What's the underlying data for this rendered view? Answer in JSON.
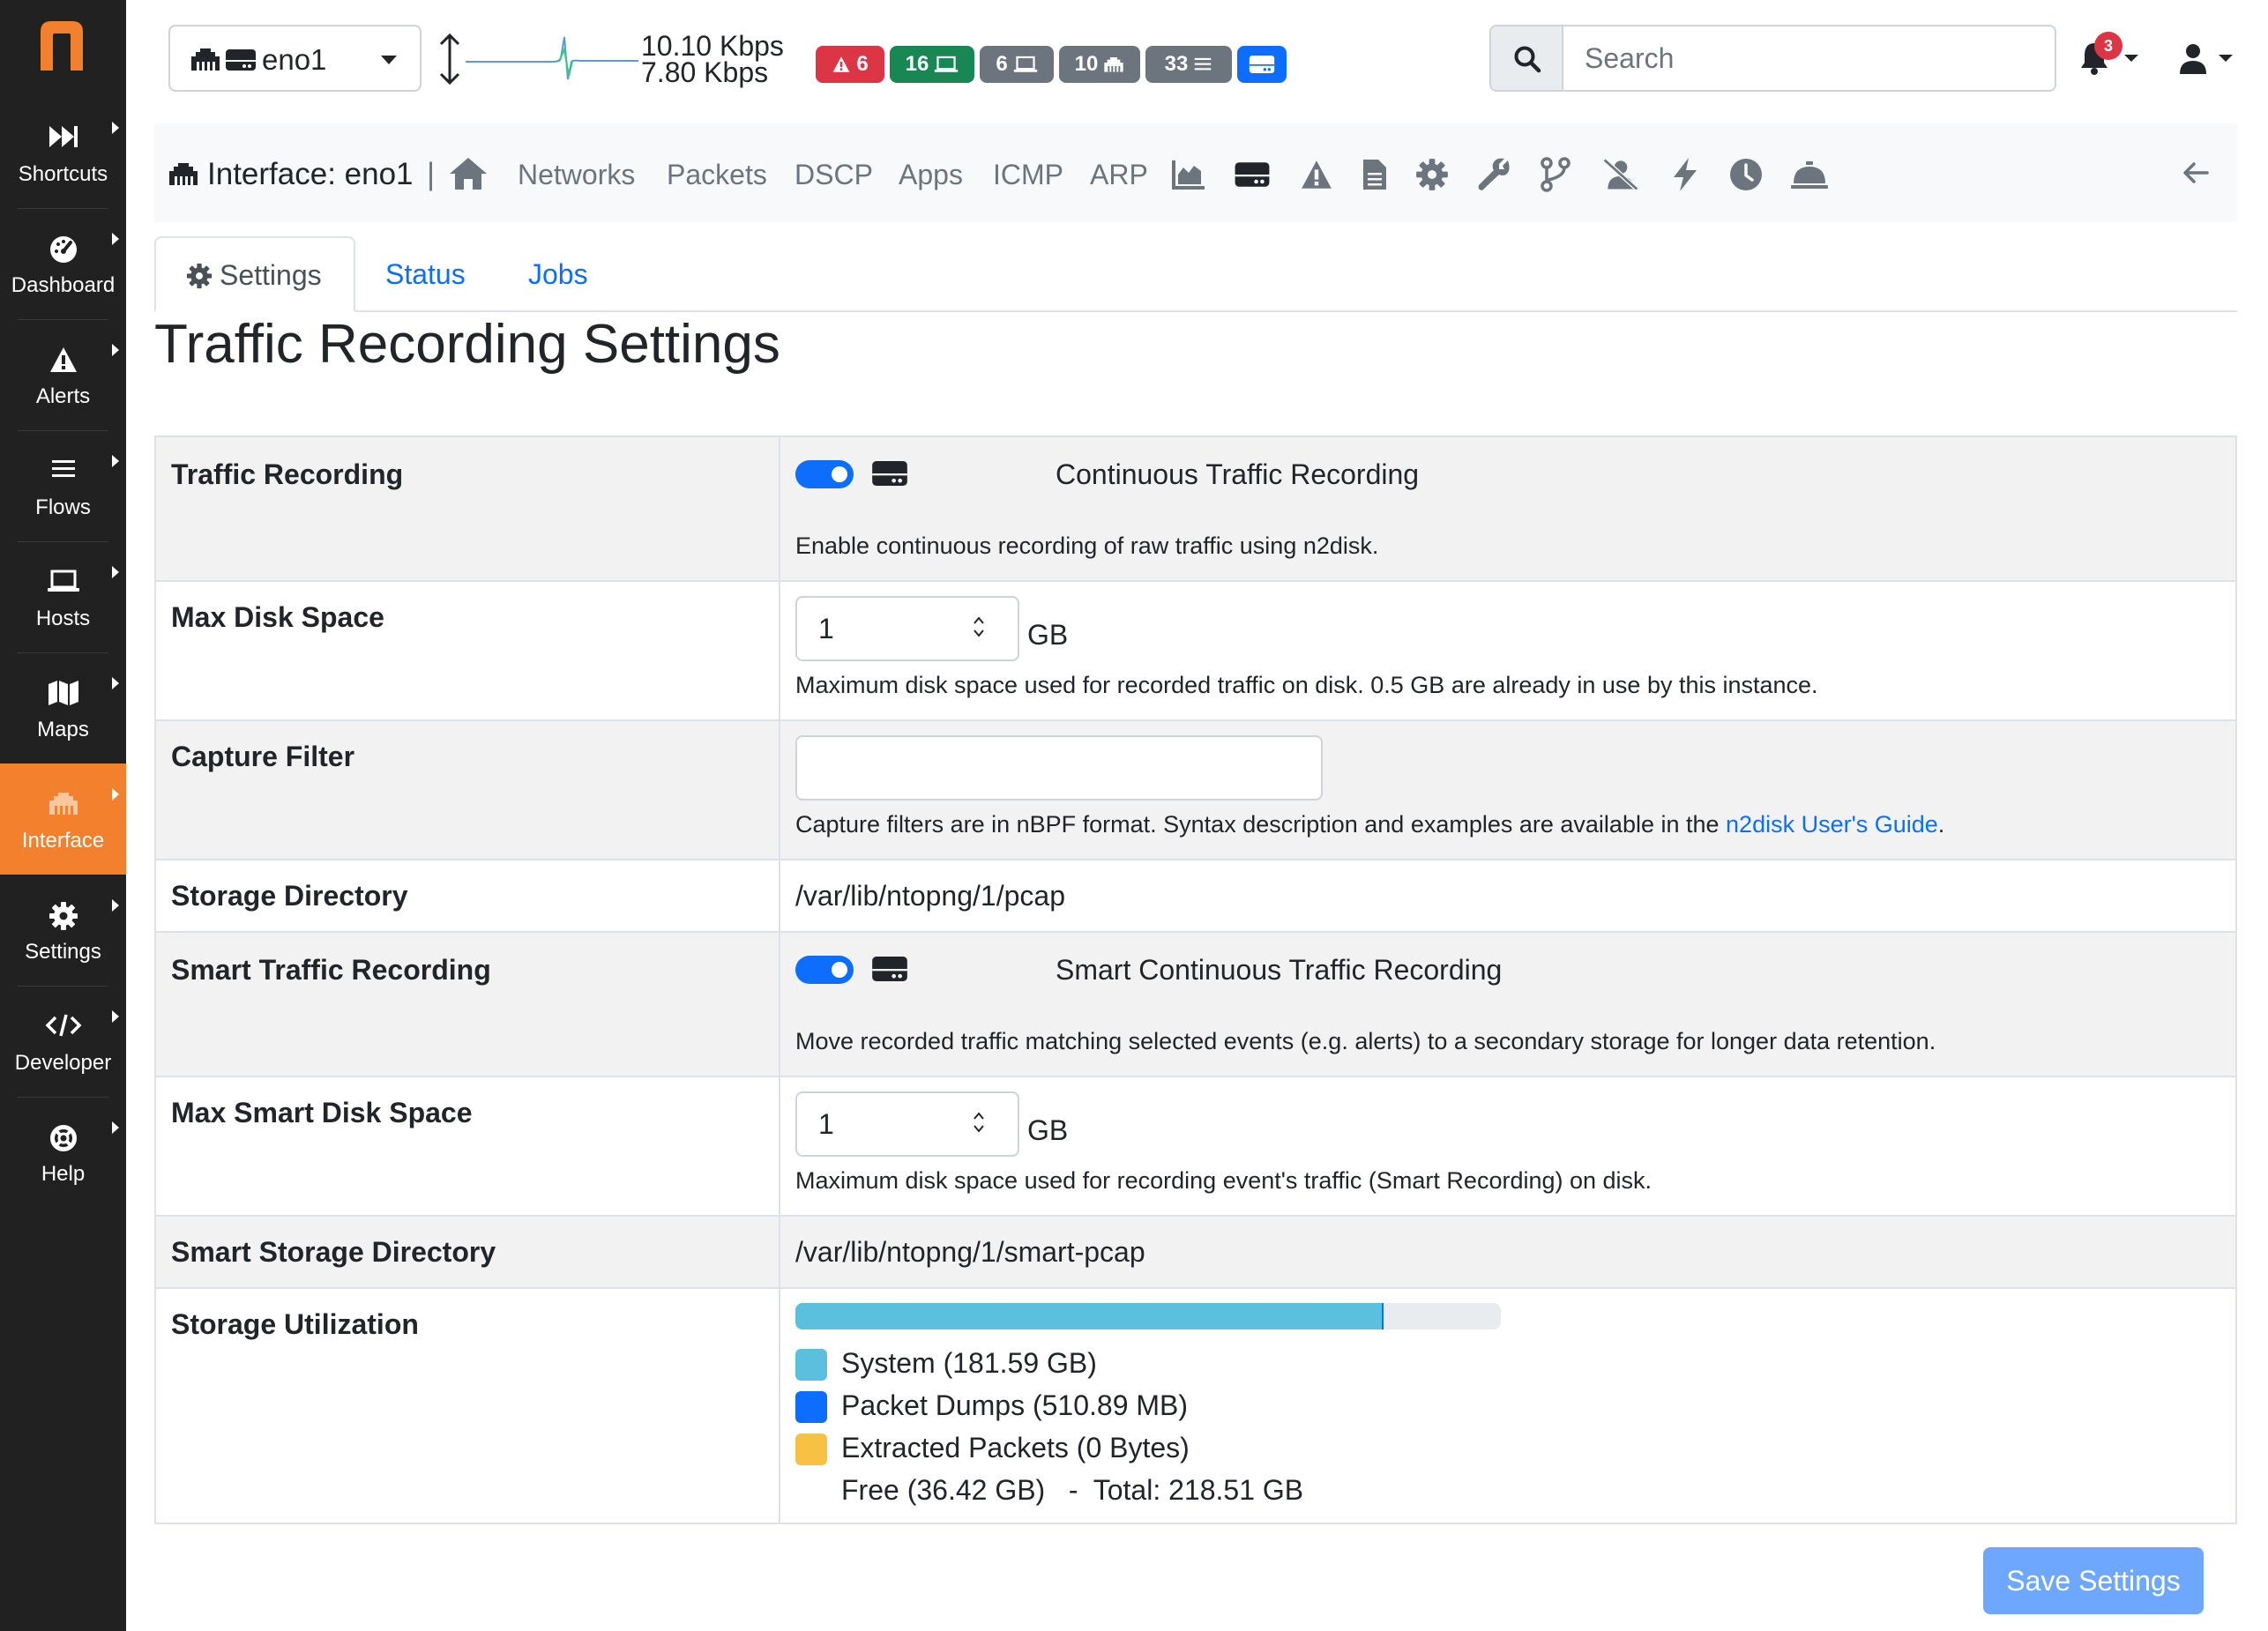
{
  "sidebar": {
    "logo": "n",
    "items": [
      {
        "label": "Shortcuts",
        "icon": "fast-forward-icon"
      },
      {
        "label": "Dashboard",
        "icon": "gauge-icon"
      },
      {
        "label": "Alerts",
        "icon": "warning-icon"
      },
      {
        "label": "Flows",
        "icon": "bars-icon"
      },
      {
        "label": "Hosts",
        "icon": "laptop-icon"
      },
      {
        "label": "Maps",
        "icon": "map-icon"
      },
      {
        "label": "Interface",
        "icon": "ethernet-icon"
      },
      {
        "label": "Settings",
        "icon": "gear-icon"
      },
      {
        "label": "Developer",
        "icon": "code-icon"
      },
      {
        "label": "Help",
        "icon": "lifebuoy-icon"
      }
    ],
    "active": "Interface"
  },
  "topbar": {
    "interface_label": "eno1",
    "rate_up": "10.10 Kbps",
    "rate_down": "7.80 Kbps",
    "badges": [
      {
        "text": "6",
        "icon": "warning-icon",
        "color": "#dc3545"
      },
      {
        "text": "16",
        "icon": "laptop-icon",
        "color": "#198754"
      },
      {
        "text": "6",
        "icon": "laptop-icon",
        "color": "#6c757d"
      },
      {
        "text": "10",
        "icon": "ethernet-icon",
        "color": "#6c757d"
      },
      {
        "text": "33",
        "icon": "bars-icon",
        "color": "#6c757d"
      },
      {
        "text": "",
        "icon": "hdd-icon",
        "color": "#0d6efd"
      }
    ],
    "search_placeholder": "Search",
    "notifications": "3"
  },
  "interface_nav": {
    "title": "Interface: eno1",
    "separator": "|",
    "links": [
      "Networks",
      "Packets",
      "DSCP",
      "Apps",
      "ICMP",
      "ARP"
    ]
  },
  "tabs": {
    "settings": "Settings",
    "status": "Status",
    "jobs": "Jobs"
  },
  "page_title": "Traffic Recording Settings",
  "settings": {
    "traffic_recording": {
      "label": "Traffic Recording",
      "toggle_label": "Continuous Traffic Recording",
      "help": "Enable continuous recording of raw traffic using n2disk."
    },
    "max_disk_space": {
      "label": "Max Disk Space",
      "value": "1",
      "unit": "GB",
      "help": "Maximum disk space used for recorded traffic on disk. 0.5 GB are already in use by this instance."
    },
    "capture_filter": {
      "label": "Capture Filter",
      "value": "",
      "help_prefix": "Capture filters are in nBPF format. Syntax description and examples are available in the ",
      "help_link": "n2disk User's Guide",
      "help_suffix": "."
    },
    "storage_directory": {
      "label": "Storage Directory",
      "value": "/var/lib/ntopng/1/pcap"
    },
    "smart_traffic_recording": {
      "label": "Smart Traffic Recording",
      "toggle_label": "Smart Continuous Traffic Recording",
      "help": "Move recorded traffic matching selected events (e.g. alerts) to a secondary storage for longer data retention."
    },
    "max_smart_disk_space": {
      "label": "Max Smart Disk Space",
      "value": "1",
      "unit": "GB",
      "help": "Maximum disk space used for recording event's traffic (Smart Recording) on disk."
    },
    "smart_storage_directory": {
      "label": "Smart Storage Directory",
      "value": "/var/lib/ntopng/1/smart-pcap"
    },
    "storage_utilization": {
      "label": "Storage Utilization",
      "system_fraction": 0.831,
      "dumps_fraction": 0.0023,
      "legend": [
        {
          "text": "System (181.59 GB)",
          "color": "#5bc0de"
        },
        {
          "text": "Packet Dumps (510.89 MB)",
          "color": "#0d6efd"
        },
        {
          "text": "Extracted Packets (0 Bytes)",
          "color": "#f7c244"
        }
      ],
      "summary": "Free (36.42 GB)   -  Total: 218.51 GB"
    }
  },
  "save_button": "Save Settings"
}
